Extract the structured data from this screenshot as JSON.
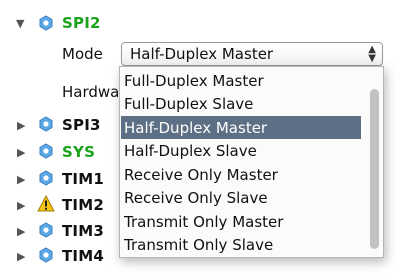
{
  "tree": {
    "spi2": {
      "label": "SPI2",
      "expanded": true,
      "color": "#1aa31a"
    },
    "mode_label": "Mode",
    "hardware_label": "Hardwa",
    "nodes": [
      {
        "label": "SPI3",
        "icon": "gear-icon"
      },
      {
        "label": "SYS",
        "icon": "gear-icon",
        "color": "#1aa31a"
      },
      {
        "label": "TIM1",
        "icon": "gear-icon"
      },
      {
        "label": "TIM2",
        "icon": "warning-icon"
      },
      {
        "label": "TIM3",
        "icon": "gear-icon"
      },
      {
        "label": "TIM4",
        "icon": "gear-icon"
      }
    ]
  },
  "mode_select": {
    "value": "Half-Duplex Master",
    "options": [
      "Full-Duplex Master",
      "Full-Duplex Slave",
      "Half-Duplex Master",
      "Half-Duplex Slave",
      "Receive Only Master",
      "Receive Only Slave",
      "Transmit Only Master",
      "Transmit Only Slave"
    ],
    "selected_index": 2,
    "highlight_color": "#5d6f84"
  }
}
